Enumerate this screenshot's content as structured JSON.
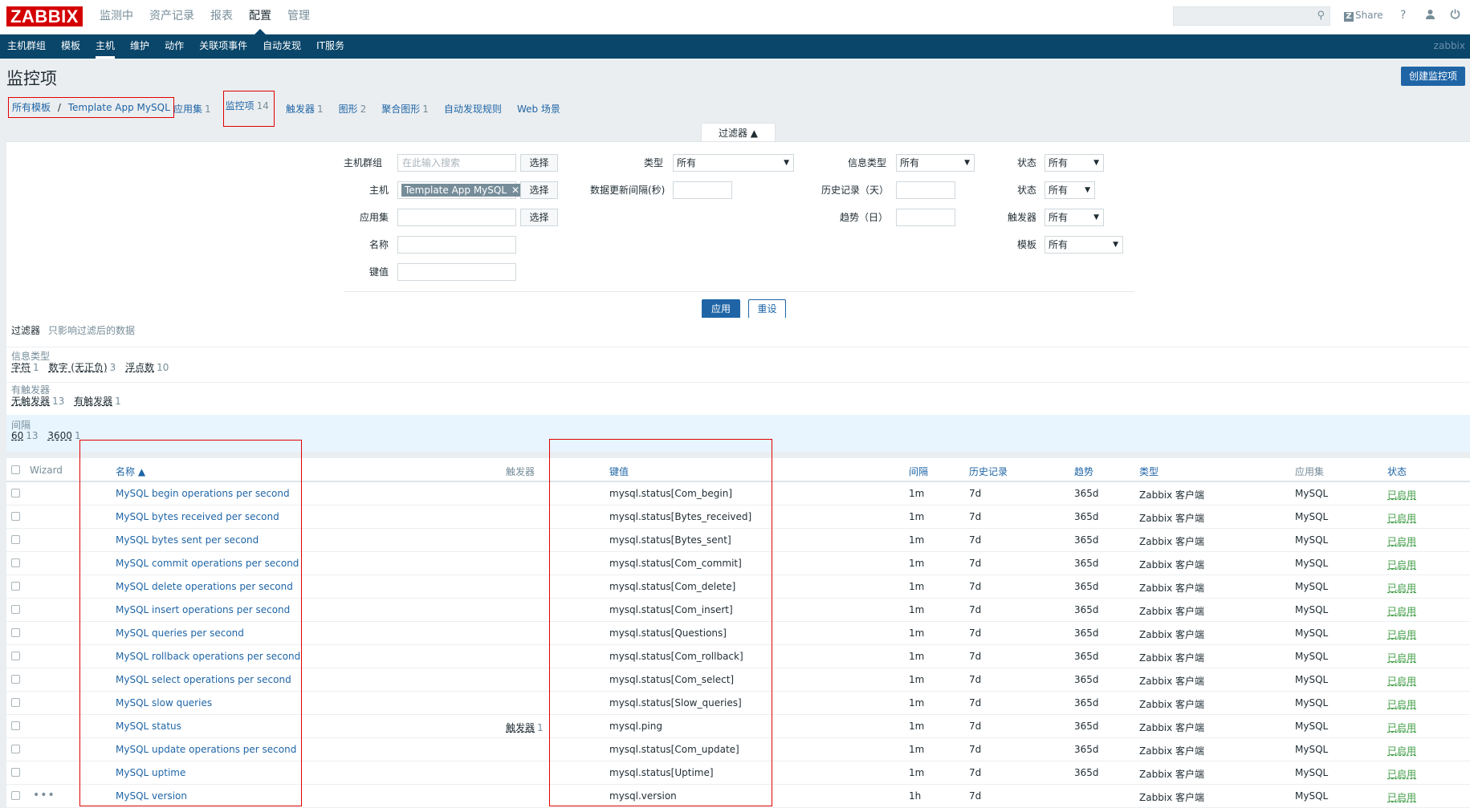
{
  "header": {
    "logo": "ZABBIX",
    "menu": [
      "监测中",
      "资产记录",
      "报表",
      "配置",
      "管理"
    ],
    "active_menu_index": 3,
    "search_placeholder": "",
    "share": "Share",
    "help_icon": "question-icon",
    "user_icon": "user-icon",
    "logout_icon": "power-icon"
  },
  "submenu": {
    "items": [
      "主机群组",
      "模板",
      "主机",
      "维护",
      "动作",
      "关联项事件",
      "自动发现",
      "IT服务"
    ],
    "active_index": 2,
    "username": "zabbix"
  },
  "page": {
    "title": "监控项",
    "create_button": "创建监控项"
  },
  "breadcrumb": {
    "all_templates": "所有模板",
    "separator": "/",
    "template": "Template App MySQL",
    "links": [
      {
        "label": "应用集",
        "count": "1"
      },
      {
        "label": "监控项",
        "count": "14"
      },
      {
        "label": "触发器",
        "count": "1"
      },
      {
        "label": "图形",
        "count": "2"
      },
      {
        "label": "聚合图形",
        "count": "1"
      },
      {
        "label": "自动发现规则",
        "count": ""
      },
      {
        "label": "Web 场景",
        "count": ""
      }
    ]
  },
  "filter": {
    "tab_label": "过滤器 ▲",
    "host_group_label": "主机群组",
    "host_group_placeholder": "在此输入搜索",
    "select_label": "选择",
    "host_label": "主机",
    "host_tag": "Template App MySQL",
    "app_label": "应用集",
    "name_label": "名称",
    "key_label": "键值",
    "type_label": "类型",
    "type_value": "所有",
    "interval_label": "数据更新间隔(秒)",
    "info_type_label": "信息类型",
    "info_type_value": "所有",
    "history_label": "历史记录（天）",
    "trends_label": "趋势（日）",
    "state_label": "状态",
    "state_value": "所有",
    "status_label": "状态",
    "status_value": "所有",
    "triggers_label": "触发器",
    "triggers_value": "所有",
    "template_label": "模板",
    "template_value": "所有",
    "apply": "应用",
    "reset": "重设"
  },
  "subfilter": {
    "title": "过滤器",
    "note": "只影响过滤后的数据",
    "groups": [
      {
        "title": "信息类型",
        "values": [
          {
            "v": "字符",
            "c": "1"
          },
          {
            "v": "数字 (无正负)",
            "c": "3"
          },
          {
            "v": "浮点数",
            "c": "10"
          }
        ]
      },
      {
        "title": "有触发器",
        "values": [
          {
            "v": "无触发器",
            "c": "13"
          },
          {
            "v": "有触发器",
            "c": "1"
          }
        ]
      },
      {
        "title": "间隔",
        "values": [
          {
            "v": "60",
            "c": "13"
          },
          {
            "v": "3600",
            "c": "1"
          }
        ]
      }
    ]
  },
  "table": {
    "headers": {
      "wizard": "Wizard",
      "name": "名称 ▲",
      "triggers": "触发器",
      "key": "键值",
      "interval": "间隔",
      "history": "历史记录",
      "trends": "趋势",
      "type": "类型",
      "applications": "应用集",
      "status": "状态"
    },
    "rows": [
      {
        "name": "MySQL begin operations per second",
        "trigger": "",
        "trigger_count": "",
        "key": "mysql.status[Com_begin]",
        "interval": "1m",
        "history": "7d",
        "trends": "365d",
        "type": "Zabbix 客户端",
        "app": "MySQL",
        "status": "已启用"
      },
      {
        "name": "MySQL bytes received per second",
        "trigger": "",
        "trigger_count": "",
        "key": "mysql.status[Bytes_received]",
        "interval": "1m",
        "history": "7d",
        "trends": "365d",
        "type": "Zabbix 客户端",
        "app": "MySQL",
        "status": "已启用"
      },
      {
        "name": "MySQL bytes sent per second",
        "trigger": "",
        "trigger_count": "",
        "key": "mysql.status[Bytes_sent]",
        "interval": "1m",
        "history": "7d",
        "trends": "365d",
        "type": "Zabbix 客户端",
        "app": "MySQL",
        "status": "已启用"
      },
      {
        "name": "MySQL commit operations per second",
        "trigger": "",
        "trigger_count": "",
        "key": "mysql.status[Com_commit]",
        "interval": "1m",
        "history": "7d",
        "trends": "365d",
        "type": "Zabbix 客户端",
        "app": "MySQL",
        "status": "已启用"
      },
      {
        "name": "MySQL delete operations per second",
        "trigger": "",
        "trigger_count": "",
        "key": "mysql.status[Com_delete]",
        "interval": "1m",
        "history": "7d",
        "trends": "365d",
        "type": "Zabbix 客户端",
        "app": "MySQL",
        "status": "已启用"
      },
      {
        "name": "MySQL insert operations per second",
        "trigger": "",
        "trigger_count": "",
        "key": "mysql.status[Com_insert]",
        "interval": "1m",
        "history": "7d",
        "trends": "365d",
        "type": "Zabbix 客户端",
        "app": "MySQL",
        "status": "已启用"
      },
      {
        "name": "MySQL queries per second",
        "trigger": "",
        "trigger_count": "",
        "key": "mysql.status[Questions]",
        "interval": "1m",
        "history": "7d",
        "trends": "365d",
        "type": "Zabbix 客户端",
        "app": "MySQL",
        "status": "已启用"
      },
      {
        "name": "MySQL rollback operations per second",
        "trigger": "",
        "trigger_count": "",
        "key": "mysql.status[Com_rollback]",
        "interval": "1m",
        "history": "7d",
        "trends": "365d",
        "type": "Zabbix 客户端",
        "app": "MySQL",
        "status": "已启用"
      },
      {
        "name": "MySQL select operations per second",
        "trigger": "",
        "trigger_count": "",
        "key": "mysql.status[Com_select]",
        "interval": "1m",
        "history": "7d",
        "trends": "365d",
        "type": "Zabbix 客户端",
        "app": "MySQL",
        "status": "已启用"
      },
      {
        "name": "MySQL slow queries",
        "trigger": "",
        "trigger_count": "",
        "key": "mysql.status[Slow_queries]",
        "interval": "1m",
        "history": "7d",
        "trends": "365d",
        "type": "Zabbix 客户端",
        "app": "MySQL",
        "status": "已启用"
      },
      {
        "name": "MySQL status",
        "trigger": "触发器",
        "trigger_count": "1",
        "key": "mysql.ping",
        "interval": "1m",
        "history": "7d",
        "trends": "365d",
        "type": "Zabbix 客户端",
        "app": "MySQL",
        "status": "已启用"
      },
      {
        "name": "MySQL update operations per second",
        "trigger": "",
        "trigger_count": "",
        "key": "mysql.status[Com_update]",
        "interval": "1m",
        "history": "7d",
        "trends": "365d",
        "type": "Zabbix 客户端",
        "app": "MySQL",
        "status": "已启用"
      },
      {
        "name": "MySQL uptime",
        "trigger": "",
        "trigger_count": "",
        "key": "mysql.status[Uptime]",
        "interval": "1m",
        "history": "7d",
        "trends": "365d",
        "type": "Zabbix 客户端",
        "app": "MySQL",
        "status": "已启用"
      },
      {
        "name": "MySQL version",
        "trigger": "",
        "trigger_count": "",
        "key": "mysql.version",
        "interval": "1h",
        "history": "7d",
        "trends": "",
        "type": "Zabbix 客户端",
        "app": "MySQL",
        "status": "已启用"
      }
    ]
  },
  "colors": {
    "brand": "#d40000",
    "nav": "#0a466a",
    "link": "#1f65a6",
    "enabled": "#429e47",
    "highlight": "#e00000"
  }
}
